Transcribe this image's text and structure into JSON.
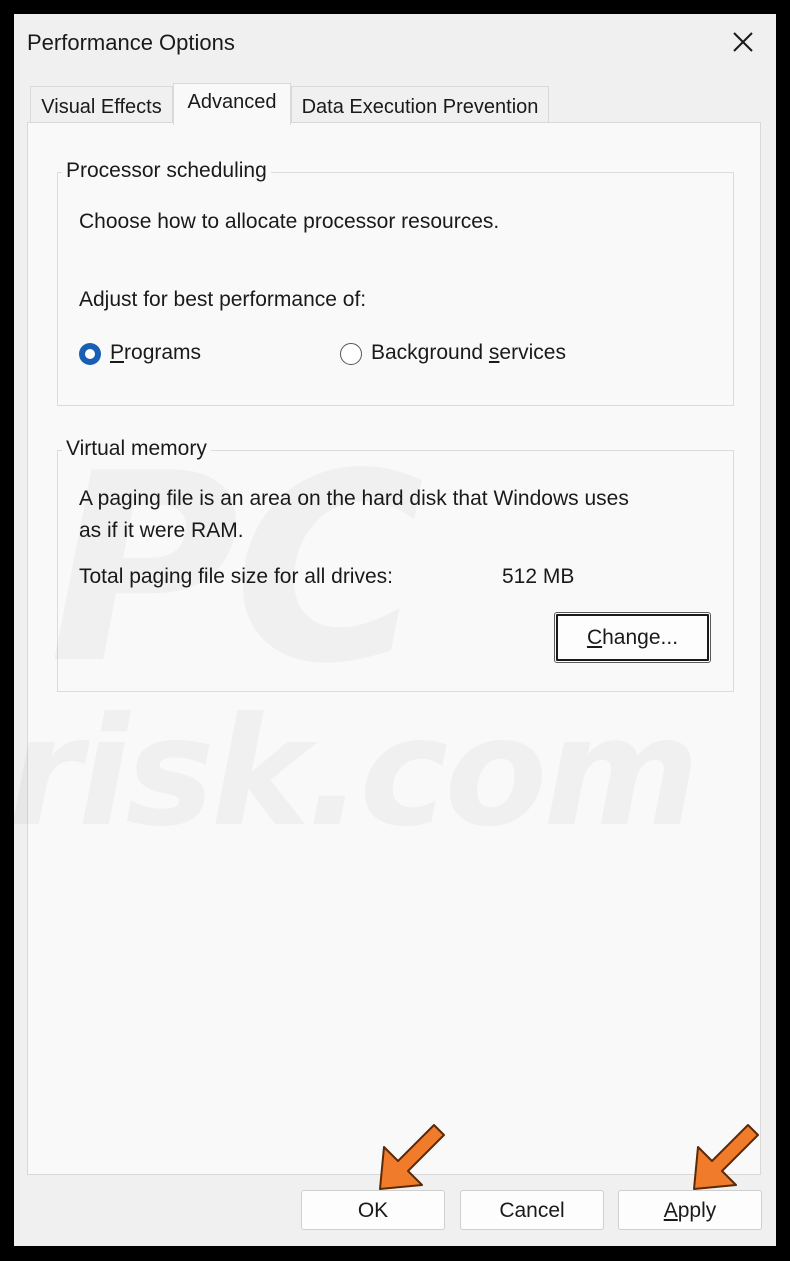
{
  "window": {
    "title": "Performance Options"
  },
  "tabs": [
    {
      "label": "Visual Effects",
      "active": false
    },
    {
      "label": "Advanced",
      "active": true
    },
    {
      "label": "Data Execution Prevention",
      "active": false
    }
  ],
  "processor_scheduling": {
    "legend": "Processor scheduling",
    "description": "Choose how to allocate processor resources.",
    "adjust_label": "Adjust for best performance of:",
    "options": [
      {
        "label_prefix": "",
        "mnemonic": "P",
        "label_suffix": "rograms",
        "selected": true
      },
      {
        "label_prefix": "Background ",
        "mnemonic": "s",
        "label_suffix": "ervices",
        "selected": false
      }
    ]
  },
  "virtual_memory": {
    "legend": "Virtual memory",
    "description_line1": "A paging file is an area on the hard disk that Windows uses",
    "description_line2": "as if it were RAM.",
    "total_label": "Total paging file size for all drives:",
    "total_value": "512 MB",
    "change_button": {
      "mnemonic": "C",
      "label_suffix": "hange..."
    }
  },
  "footer": {
    "ok_label": "OK",
    "cancel_label": "Cancel",
    "apply_mnemonic": "A",
    "apply_suffix": "pply"
  },
  "watermark": {
    "line1": "PC",
    "line2": "risk.com"
  },
  "colors": {
    "radio_selected": "#1a5fb4",
    "arrow": "#f07c2b"
  }
}
